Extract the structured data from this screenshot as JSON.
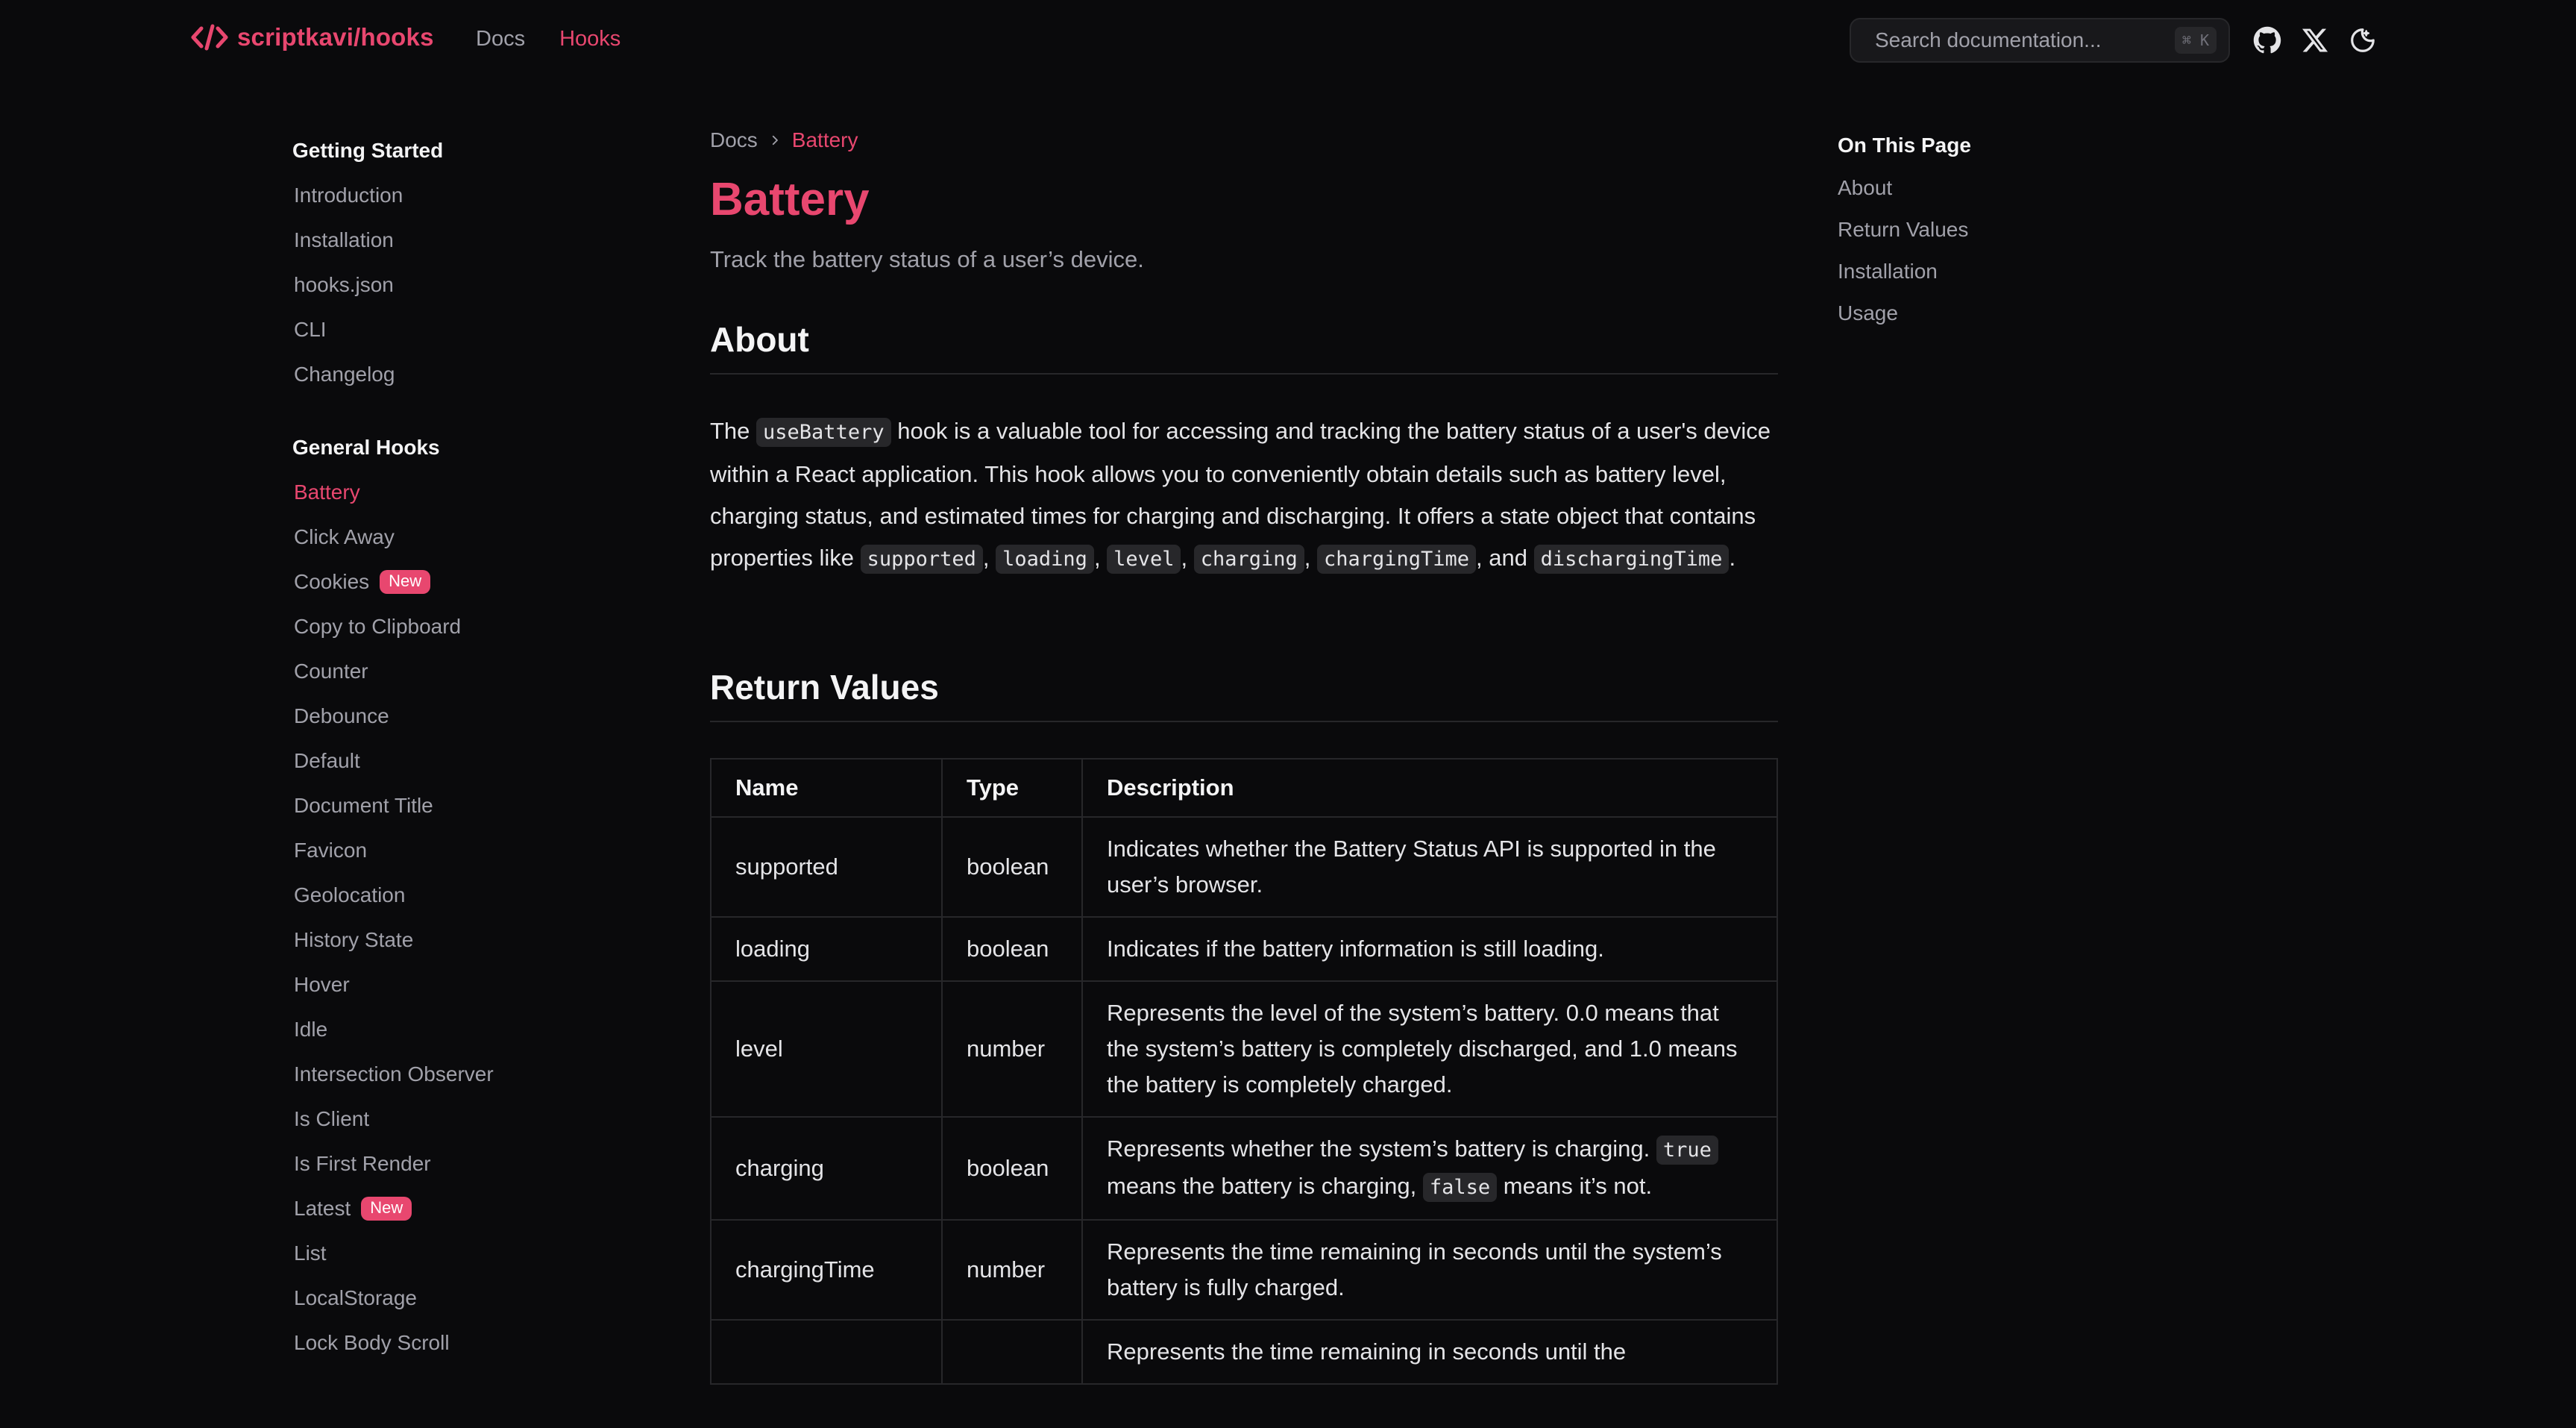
{
  "header": {
    "brand": "scriptkavi/hooks",
    "nav": [
      {
        "label": "Docs",
        "active": false
      },
      {
        "label": "Hooks",
        "active": true
      }
    ],
    "search": {
      "placeholder": "Search documentation...",
      "shortcut": "⌘ K"
    },
    "icons": [
      "github-icon",
      "x-twitter-icon",
      "theme-toggle-icon"
    ]
  },
  "sidebar": {
    "sections": [
      {
        "title": "Getting Started",
        "items": [
          {
            "label": "Introduction"
          },
          {
            "label": "Installation"
          },
          {
            "label": "hooks.json"
          },
          {
            "label": "CLI"
          },
          {
            "label": "Changelog"
          }
        ]
      },
      {
        "title": "General Hooks",
        "items": [
          {
            "label": "Battery",
            "active": true
          },
          {
            "label": "Click Away"
          },
          {
            "label": "Cookies",
            "badge": "New"
          },
          {
            "label": "Copy to Clipboard"
          },
          {
            "label": "Counter"
          },
          {
            "label": "Debounce"
          },
          {
            "label": "Default"
          },
          {
            "label": "Document Title"
          },
          {
            "label": "Favicon"
          },
          {
            "label": "Geolocation"
          },
          {
            "label": "History State"
          },
          {
            "label": "Hover"
          },
          {
            "label": "Idle"
          },
          {
            "label": "Intersection Observer"
          },
          {
            "label": "Is Client"
          },
          {
            "label": "Is First Render"
          },
          {
            "label": "Latest",
            "badge": "New"
          },
          {
            "label": "List"
          },
          {
            "label": "LocalStorage"
          },
          {
            "label": "Lock Body Scroll"
          }
        ]
      }
    ]
  },
  "main": {
    "breadcrumb": {
      "root": "Docs",
      "current": "Battery"
    },
    "title": "Battery",
    "subtitle": "Track the battery status of a user’s device.",
    "about": {
      "heading": "About",
      "p_the": "The ",
      "code_hook": "useBattery",
      "p_body": " hook is a valuable tool for accessing and tracking the battery status of a user's device within a React application. This hook allows you to conveniently obtain details such as battery level, charging status, and estimated times for charging and discharging. It offers a state object that contains properties like ",
      "props": [
        "supported",
        "loading",
        "level",
        "charging",
        "chargingTime"
      ],
      "sep": ", ",
      "and": ", and ",
      "last_prop": "dischargingTime",
      "end": "."
    },
    "return_values": {
      "heading": "Return Values",
      "headers": [
        "Name",
        "Type",
        "Description"
      ],
      "rows": [
        {
          "name": "supported",
          "type": "boolean",
          "desc": "Indicates whether the Battery Status API is supported in the user’s browser."
        },
        {
          "name": "loading",
          "type": "boolean",
          "desc": "Indicates if the battery information is still loading."
        },
        {
          "name": "level",
          "type": "number",
          "desc": "Represents the level of the system’s battery. 0.0 means that the system’s battery is completely discharged, and 1.0 means the battery is completely charged."
        },
        {
          "name": "charging",
          "type": "boolean",
          "desc_pre": "Represents whether the system’s battery is charging. ",
          "code_true": "true",
          "desc_mid": " means the battery is charging, ",
          "code_false": "false",
          "desc_post": " means it’s not."
        },
        {
          "name": "chargingTime",
          "type": "number",
          "desc": "Represents the time remaining in seconds until the system’s battery is fully charged."
        },
        {
          "name": "",
          "type": "",
          "desc": "Represents the time remaining in seconds until the"
        }
      ]
    }
  },
  "toc": {
    "title": "On This Page",
    "items": [
      "About",
      "Return Values",
      "Installation",
      "Usage"
    ]
  }
}
